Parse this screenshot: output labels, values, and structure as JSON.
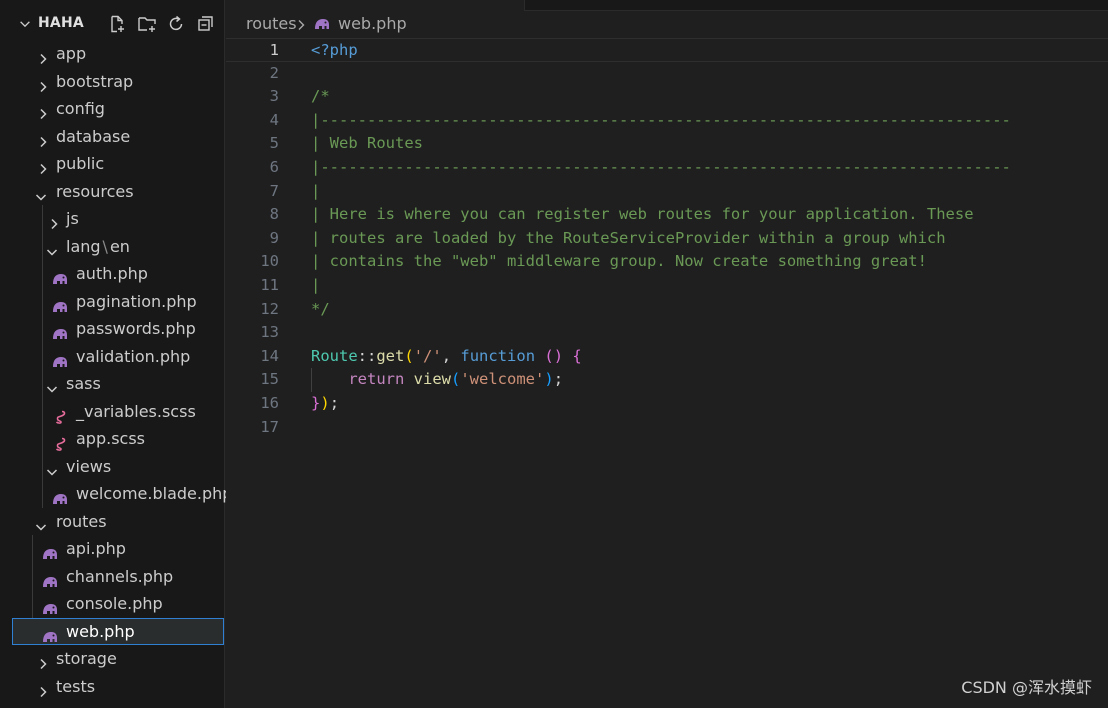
{
  "explorer": {
    "title": "HAHA",
    "actions": [
      "new-file",
      "new-folder",
      "refresh",
      "collapse-all"
    ],
    "tree": [
      {
        "label": "app",
        "icon": "chevron-right-icon",
        "kind": "folder"
      },
      {
        "label": "bootstrap",
        "icon": "chevron-right-icon",
        "kind": "folder"
      },
      {
        "label": "config",
        "icon": "chevron-right-icon",
        "kind": "folder"
      },
      {
        "label": "database",
        "icon": "chevron-right-icon",
        "kind": "folder"
      },
      {
        "label": "public",
        "icon": "chevron-right-icon",
        "kind": "folder"
      },
      {
        "label": "resources",
        "icon": "chevron-down-icon",
        "kind": "folder"
      },
      {
        "label": "js",
        "icon": "chevron-right-icon",
        "kind": "folder"
      },
      {
        "label": "lang",
        "label_sep": "\\",
        "label_tail": "en",
        "icon": "chevron-down-icon",
        "kind": "folder"
      },
      {
        "label": "auth.php",
        "icon": "php-icon",
        "kind": "file"
      },
      {
        "label": "pagination.php",
        "icon": "php-icon",
        "kind": "file"
      },
      {
        "label": "passwords.php",
        "icon": "php-icon",
        "kind": "file"
      },
      {
        "label": "validation.php",
        "icon": "php-icon",
        "kind": "file"
      },
      {
        "label": "sass",
        "icon": "chevron-down-icon",
        "kind": "folder"
      },
      {
        "label": "_variables.scss",
        "icon": "sass-icon",
        "kind": "file"
      },
      {
        "label": "app.scss",
        "icon": "sass-icon",
        "kind": "file"
      },
      {
        "label": "views",
        "icon": "chevron-down-icon",
        "kind": "folder"
      },
      {
        "label": "welcome.blade.php",
        "icon": "php-icon",
        "kind": "file"
      },
      {
        "label": "routes",
        "icon": "chevron-down-icon",
        "kind": "folder"
      },
      {
        "label": "api.php",
        "icon": "php-icon",
        "kind": "file"
      },
      {
        "label": "channels.php",
        "icon": "php-icon",
        "kind": "file"
      },
      {
        "label": "console.php",
        "icon": "php-icon",
        "kind": "file"
      },
      {
        "label": "web.php",
        "icon": "php-icon",
        "kind": "file",
        "selected": true
      },
      {
        "label": "storage",
        "icon": "chevron-right-icon",
        "kind": "folder"
      },
      {
        "label": "tests",
        "icon": "chevron-right-icon",
        "kind": "folder"
      }
    ]
  },
  "breadcrumb": {
    "folder": "routes",
    "file": "web.php"
  },
  "editor": {
    "active_line": 1,
    "lines": [
      {
        "n": "1",
        "text": "<?php"
      },
      {
        "n": "2",
        "text": ""
      },
      {
        "n": "3",
        "text": "/*"
      },
      {
        "n": "4",
        "text": "|--------------------------------------------------------------------------"
      },
      {
        "n": "5",
        "text": "| Web Routes"
      },
      {
        "n": "6",
        "text": "|--------------------------------------------------------------------------"
      },
      {
        "n": "7",
        "text": "|"
      },
      {
        "n": "8",
        "text": "| Here is where you can register web routes for your application. These"
      },
      {
        "n": "9",
        "text": "| routes are loaded by the RouteServiceProvider within a group which"
      },
      {
        "n": "10",
        "text": "| contains the \"web\" middleware group. Now create something great!"
      },
      {
        "n": "11",
        "text": "|"
      },
      {
        "n": "12",
        "text": "*/"
      },
      {
        "n": "13",
        "text": ""
      },
      {
        "n": "14",
        "text": "Route::get('/', function () {"
      },
      {
        "n": "15",
        "text": "    return view('welcome');"
      },
      {
        "n": "16",
        "text": "});"
      },
      {
        "n": "17",
        "text": ""
      }
    ]
  },
  "watermark": "CSDN @浑水摸虾",
  "colors": {
    "background": "#1f1f1f",
    "sidebar": "#181818",
    "comment": "#6a9955",
    "keyword": "#569cd6",
    "string": "#ce9178",
    "function": "#dcdcaa",
    "class": "#4ec9b0",
    "selection_border": "#2f7fd2"
  }
}
